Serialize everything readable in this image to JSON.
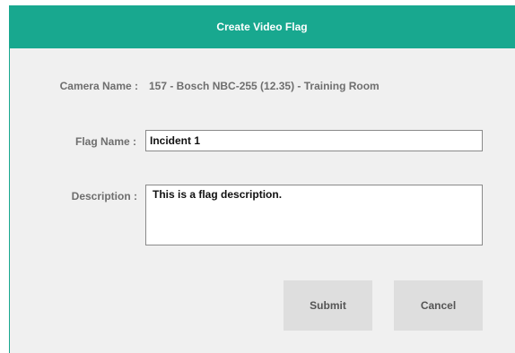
{
  "dialog": {
    "title": "Create Video Flag"
  },
  "camera": {
    "label": "Camera Name :",
    "value": "157 - Bosch NBC-255 (12.35) - Training Room"
  },
  "flag_name": {
    "label": "Flag Name :",
    "value": "Incident 1"
  },
  "description": {
    "label": "Description :",
    "value": "This is a flag description."
  },
  "buttons": {
    "submit_label": "Submit",
    "cancel_label": "Cancel"
  },
  "colors": {
    "accent": "#18a88f",
    "panel_background": "#f0f0f0",
    "button_background": "#dedede"
  }
}
